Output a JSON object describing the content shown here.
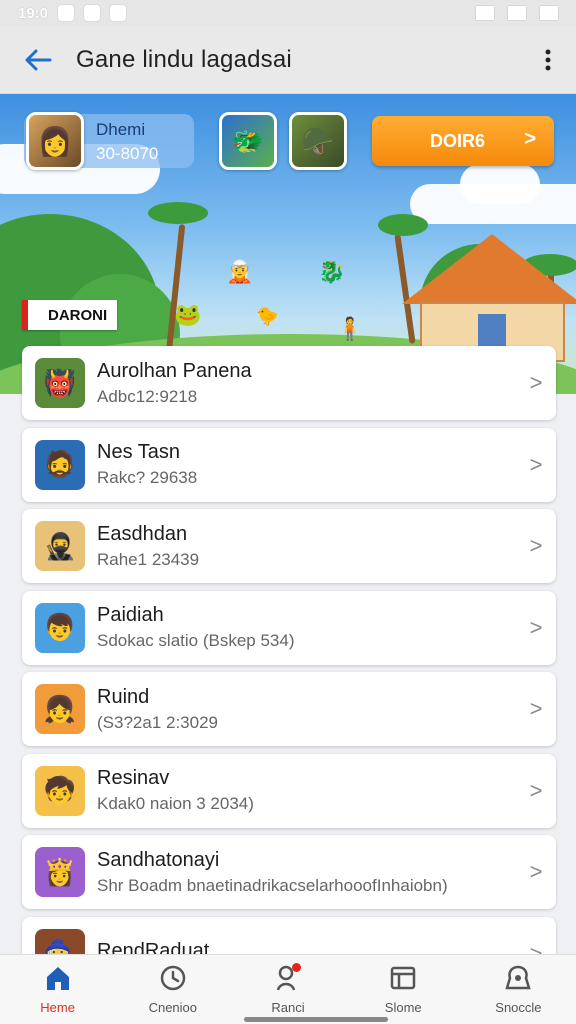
{
  "status_bar": {
    "time": "19:0"
  },
  "app_bar": {
    "title": "Gane lindu lagadsai"
  },
  "hero": {
    "player_name": "Dhemi",
    "player_score": "30-8070",
    "cta_label": "DOIR6",
    "cta_chevron": ">",
    "banner_label": "DARONI"
  },
  "games": [
    {
      "title": "Aurolhan Panena",
      "subtitle": "Adbc12:9218",
      "icon": "ogre-icon",
      "icon_bg": "#5b8a3a"
    },
    {
      "title": "Nes Tasn",
      "subtitle": "Rakc? 29638",
      "icon": "warrior-icon",
      "icon_bg": "#2a6db5"
    },
    {
      "title": "Easdhdan",
      "subtitle": "Rahe1 23439",
      "icon": "ninja-icon",
      "icon_bg": "#e9c27a"
    },
    {
      "title": "Paidiah",
      "subtitle": "Sdokac slatio (Bskep 534)",
      "icon": "boy-icon",
      "icon_bg": "#4aa0e0"
    },
    {
      "title": "Ruind",
      "subtitle": "(S3?2a1 2:3029",
      "icon": "girl-icon",
      "icon_bg": "#f29b3a"
    },
    {
      "title": "Resinav",
      "subtitle": "Kdak0 naion 3 2034)",
      "icon": "kid-icon",
      "icon_bg": "#f5c04a"
    },
    {
      "title": "Sandhatonayi",
      "subtitle": "Shr Boadm bnaetinadrikacselarhooofInhaiobn)",
      "icon": "princess-icon",
      "icon_bg": "#9b5fd0"
    },
    {
      "title": "RendRaduat",
      "subtitle": "",
      "icon": "hero-icon",
      "icon_bg": "#8a4a2a"
    }
  ],
  "chevron": ">",
  "bottom_nav": [
    {
      "label": "Heme",
      "icon": "home-icon",
      "active": true
    },
    {
      "label": "Cnenioo",
      "icon": "clock-icon",
      "active": false
    },
    {
      "label": "Ranci",
      "icon": "person-icon",
      "active": false
    },
    {
      "label": "Slome",
      "icon": "store-icon",
      "active": false
    },
    {
      "label": "Snoccle",
      "icon": "profile-icon",
      "active": false
    }
  ],
  "colors": {
    "accent": "#1f6fd1",
    "cta": "#f58a0b",
    "active_nav": "#d93025"
  }
}
